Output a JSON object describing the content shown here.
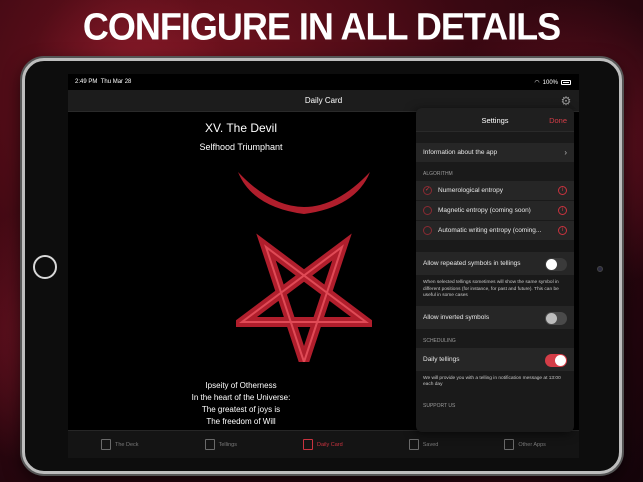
{
  "headline": "CONFIGURE IN ALL DETAILS",
  "status": {
    "time": "2:49 PM",
    "date": "Thu Mar 28",
    "battery": "100%"
  },
  "nav": {
    "title": "Daily Card",
    "settings_icon": "gear-icon"
  },
  "card": {
    "title": "XV. The Devil",
    "subtitle": "Selfhood Triumphant",
    "lines": [
      "Ipseity of Otherness",
      "In the heart of the Universe:",
      "The greatest of joys is",
      "The freedom of Will"
    ]
  },
  "tabs": [
    {
      "label": "The Deck",
      "icon": "card-icon"
    },
    {
      "label": "Tellings",
      "icon": "hand-icon"
    },
    {
      "label": "Daily Card",
      "icon": "calendar-icon",
      "active": true
    },
    {
      "label": "Saved",
      "icon": "list-icon"
    },
    {
      "label": "Other Apps",
      "icon": "grid-icon"
    }
  ],
  "settings": {
    "title": "Settings",
    "done": "Done",
    "info_row": "Information about the app",
    "algorithm_label": "ALGORITHM",
    "algorithms": [
      {
        "label": "Numerological entropy",
        "selected": true
      },
      {
        "label": "Magnetic entropy (coming soon)",
        "selected": false
      },
      {
        "label": "Automatic writing entropy (coming...",
        "selected": false
      }
    ],
    "repeated": {
      "label": "Allow repeated symbols in tellings",
      "on": false
    },
    "repeated_note": "When selected tellings sometimes will show the same symbol in different positions (for instance, for past and future). This can be useful in some cases",
    "inverted": {
      "label": "Allow inverted symbols",
      "on": false
    },
    "scheduling_label": "SCHEDULING",
    "daily": {
      "label": "Daily tellings",
      "on": true
    },
    "daily_note": "We will provide you with a telling in notification message at 13:00 each day",
    "support_label": "SUPPORT US"
  },
  "colors": {
    "accent": "#d43d47",
    "symbol": "#b01e2c"
  }
}
